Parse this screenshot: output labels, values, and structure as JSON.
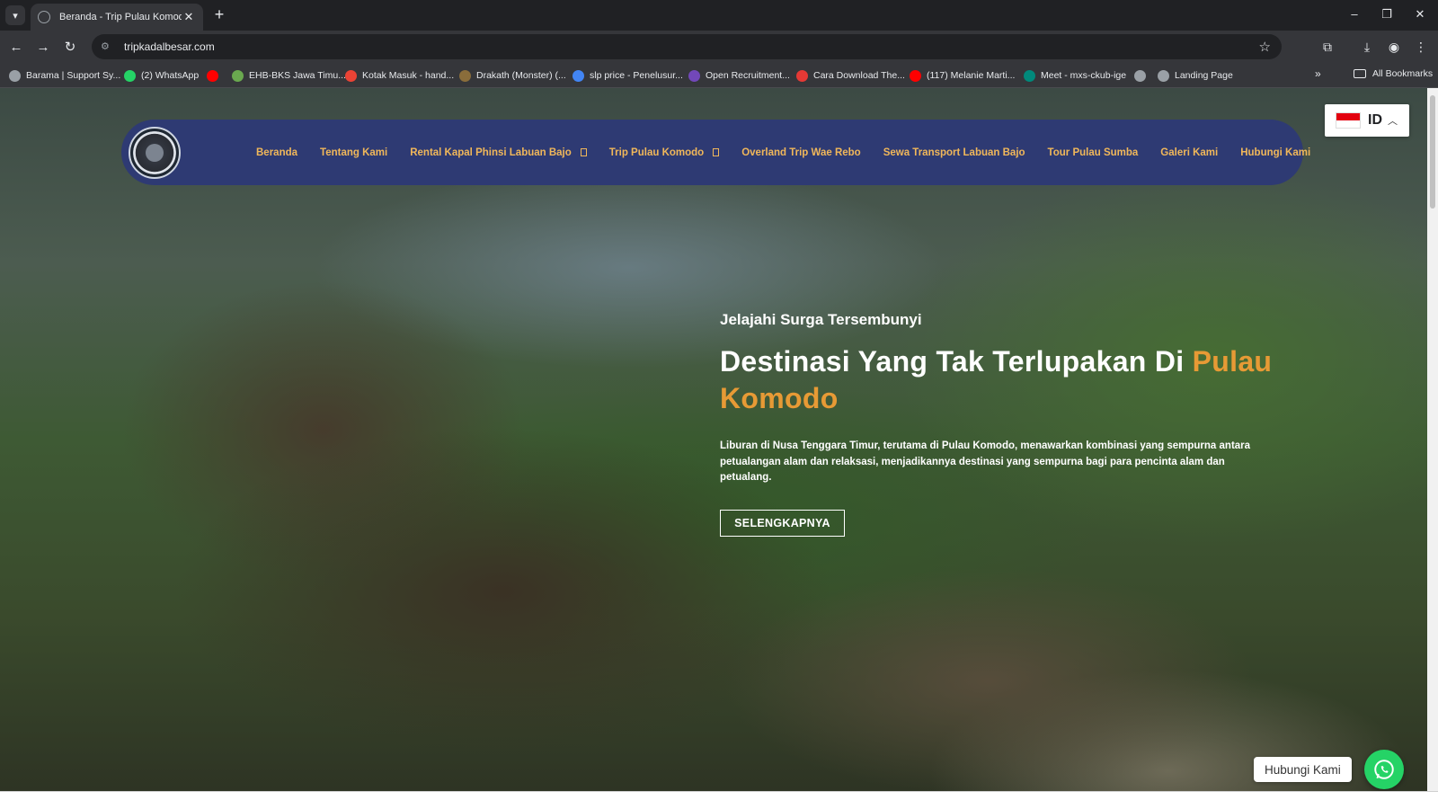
{
  "browser": {
    "tab_title": "Beranda - Trip Pulau Komodo",
    "tab_close": "✕",
    "new_tab": "+",
    "url": "tripkadalbesar.com",
    "win_min": "–",
    "win_max": "❐",
    "win_close": "✕",
    "bookmarks": [
      {
        "label": "Barama | Support Sy...",
        "icon": "globe-icon",
        "color": "#9aa0a6"
      },
      {
        "label": "(2) WhatsApp",
        "icon": "whatsapp-icon",
        "color": "#25d366"
      },
      {
        "label": "",
        "icon": "youtube-icon",
        "color": "#ff0000"
      },
      {
        "label": "EHB-BKS Jawa Timu...",
        "icon": "site-icon",
        "color": "#6aa84f"
      },
      {
        "label": "Kotak Masuk - hand...",
        "icon": "gmail-icon",
        "color": "#ea4335"
      },
      {
        "label": "Drakath (Monster) (...",
        "icon": "site-icon",
        "color": "#8a6d3b"
      },
      {
        "label": "slp price - Penelusur...",
        "icon": "google-icon",
        "color": "#4285f4"
      },
      {
        "label": "Open Recruitment...",
        "icon": "forms-icon",
        "color": "#7248b9"
      },
      {
        "label": "Cara Download The...",
        "icon": "site-icon",
        "color": "#e53935"
      },
      {
        "label": "(117) Melanie Marti...",
        "icon": "youtube-icon",
        "color": "#ff0000"
      },
      {
        "label": "Meet - mxs-ckub-ige",
        "icon": "meet-icon",
        "color": "#00897b"
      },
      {
        "label": "",
        "icon": "globe-icon",
        "color": "#9aa0a6"
      },
      {
        "label": "Landing Page",
        "icon": "globe-icon",
        "color": "#9aa0a6"
      }
    ],
    "bookmarks_more": "»",
    "all_bookmarks": "All Bookmarks"
  },
  "site": {
    "nav": [
      {
        "label": "Beranda",
        "dropdown": false
      },
      {
        "label": "Tentang Kami",
        "dropdown": false
      },
      {
        "label": "Rental Kapal Phinsi Labuan Bajo",
        "dropdown": true
      },
      {
        "label": "Trip Pulau Komodo",
        "dropdown": true
      },
      {
        "label": "Overland Trip Wae Rebo",
        "dropdown": false
      },
      {
        "label": "Sewa Transport Labuan Bajo",
        "dropdown": false
      },
      {
        "label": "Tour Pulau Sumba",
        "dropdown": false
      },
      {
        "label": "Galeri Kami",
        "dropdown": false
      },
      {
        "label": "Hubungi Kami",
        "dropdown": false
      }
    ],
    "lang": {
      "code": "ID",
      "chevron": "︿"
    },
    "hero": {
      "kicker": "Jelajahi Surga Tersembunyi",
      "title_main": "Destinasi Yang Tak Terlupakan Di",
      "title_highlight": "Pulau Komodo",
      "description": "Liburan di Nusa Tenggara Timur, terutama di Pulau Komodo, menawarkan kombinasi yang sempurna antara petualangan alam dan relaksasi, menjadikannya destinasi yang sempurna bagi para pencinta alam dan petualang.",
      "button": "SELENGKAPNYA"
    },
    "whatsapp_label": "Hubungi Kami"
  },
  "colors": {
    "nav_bg": "#2e3a73",
    "nav_text": "#f0b75a",
    "highlight": "#e79a35",
    "whatsapp": "#25d366"
  }
}
